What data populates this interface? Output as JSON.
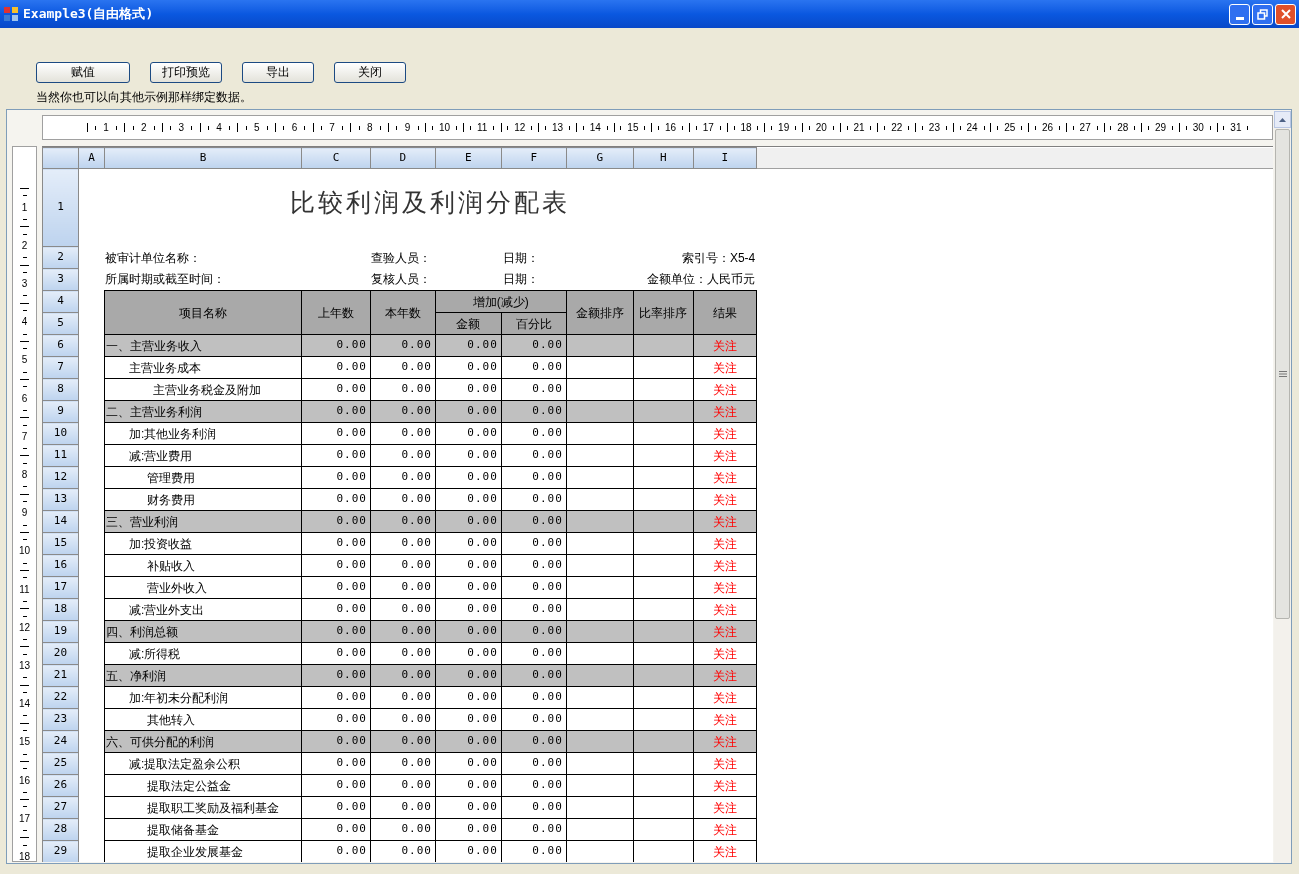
{
  "window": {
    "title": "Example3(自由格式)"
  },
  "buttons": [
    "赋值",
    "打印预览",
    "导出",
    "关闭"
  ],
  "note": "当然你也可以向其他示例那样绑定数据。",
  "ruler": {
    "marks": [
      "1",
      "2",
      "3",
      "4",
      "5",
      "6",
      "7",
      "8",
      "9",
      "10",
      "11",
      "12",
      "13",
      "14",
      "15",
      "16",
      "17",
      "18",
      "19",
      "20",
      "21",
      "22",
      "23",
      "24",
      "25",
      "26",
      "27",
      "28",
      "29",
      "30",
      "31"
    ]
  },
  "vertical_ruler": {
    "marks": [
      "1",
      "2",
      "3",
      "4",
      "5",
      "6",
      "7",
      "8",
      "9",
      "10",
      "11",
      "12",
      "13",
      "14",
      "15",
      "16",
      "17",
      "18"
    ]
  },
  "sheet": {
    "columns": [
      "A",
      "B",
      "C",
      "D",
      "E",
      "F",
      "G",
      "H",
      "I"
    ],
    "row_numbers": [
      "1",
      "2",
      "3",
      "4",
      "5",
      "6",
      "7",
      "8",
      "9",
      "10",
      "11",
      "12",
      "13",
      "14",
      "15",
      "16",
      "17",
      "18",
      "19",
      "20",
      "21",
      "22",
      "23",
      "24",
      "25",
      "26",
      "27",
      "28",
      "29"
    ],
    "title": "比较利润及利润分配表",
    "info_rows": [
      {
        "left": "被审计单位名称：",
        "reviewer": "查验人员：",
        "date": "日期：",
        "right": "索引号：X5-4"
      },
      {
        "left": "所属时期或截至时间：",
        "reviewer": "复核人员：",
        "date": "日期：",
        "right": "金额单位：人民币元"
      }
    ],
    "header": {
      "name": "项目名称",
      "prev": "上年数",
      "curr": "本年数",
      "change": "增加(减少)",
      "amount": "金额",
      "pct": "百分比",
      "amount_rank": "金额排序",
      "rate_rank": "比率排序",
      "result": "结果"
    },
    "rows": [
      {
        "name": "一、主营业务收入",
        "kind": "section",
        "prev": "0.00",
        "curr": "0.00",
        "amount": "0.00",
        "pct": "0.00",
        "result": "关注"
      },
      {
        "name": "主营业务成本",
        "kind": "item",
        "prev": "0.00",
        "curr": "0.00",
        "amount": "0.00",
        "pct": "0.00",
        "result": "关注"
      },
      {
        "name": "主营业务税金及附加",
        "kind": "deep",
        "prev": "0.00",
        "curr": "0.00",
        "amount": "0.00",
        "pct": "0.00",
        "result": "关注"
      },
      {
        "name": "二、主营业务利润",
        "kind": "section",
        "prev": "0.00",
        "curr": "0.00",
        "amount": "0.00",
        "pct": "0.00",
        "result": "关注"
      },
      {
        "name": "加:其他业务利润",
        "kind": "item",
        "prev": "0.00",
        "curr": "0.00",
        "amount": "0.00",
        "pct": "0.00",
        "result": "关注"
      },
      {
        "name": "减:营业费用",
        "kind": "item",
        "prev": "0.00",
        "curr": "0.00",
        "amount": "0.00",
        "pct": "0.00",
        "result": "关注"
      },
      {
        "name": "管理费用",
        "kind": "detail",
        "prev": "0.00",
        "curr": "0.00",
        "amount": "0.00",
        "pct": "0.00",
        "result": "关注"
      },
      {
        "name": "财务费用",
        "kind": "detail",
        "prev": "0.00",
        "curr": "0.00",
        "amount": "0.00",
        "pct": "0.00",
        "result": "关注"
      },
      {
        "name": "三、营业利润",
        "kind": "section",
        "prev": "0.00",
        "curr": "0.00",
        "amount": "0.00",
        "pct": "0.00",
        "result": "关注"
      },
      {
        "name": "加:投资收益",
        "kind": "item",
        "prev": "0.00",
        "curr": "0.00",
        "amount": "0.00",
        "pct": "0.00",
        "result": "关注"
      },
      {
        "name": "补贴收入",
        "kind": "detail",
        "prev": "0.00",
        "curr": "0.00",
        "amount": "0.00",
        "pct": "0.00",
        "result": "关注"
      },
      {
        "name": "营业外收入",
        "kind": "detail",
        "prev": "0.00",
        "curr": "0.00",
        "amount": "0.00",
        "pct": "0.00",
        "result": "关注"
      },
      {
        "name": "减:营业外支出",
        "kind": "item",
        "prev": "0.00",
        "curr": "0.00",
        "amount": "0.00",
        "pct": "0.00",
        "result": "关注"
      },
      {
        "name": "四、利润总额",
        "kind": "section",
        "prev": "0.00",
        "curr": "0.00",
        "amount": "0.00",
        "pct": "0.00",
        "result": "关注"
      },
      {
        "name": "减:所得税",
        "kind": "item",
        "prev": "0.00",
        "curr": "0.00",
        "amount": "0.00",
        "pct": "0.00",
        "result": "关注"
      },
      {
        "name": "五、净利润",
        "kind": "section",
        "prev": "0.00",
        "curr": "0.00",
        "amount": "0.00",
        "pct": "0.00",
        "result": "关注"
      },
      {
        "name": "加:年初未分配利润",
        "kind": "item",
        "prev": "0.00",
        "curr": "0.00",
        "amount": "0.00",
        "pct": "0.00",
        "result": "关注"
      },
      {
        "name": "其他转入",
        "kind": "detail",
        "prev": "0.00",
        "curr": "0.00",
        "amount": "0.00",
        "pct": "0.00",
        "result": "关注"
      },
      {
        "name": "六、可供分配的利润",
        "kind": "section",
        "prev": "0.00",
        "curr": "0.00",
        "amount": "0.00",
        "pct": "0.00",
        "result": "关注"
      },
      {
        "name": "减:提取法定盈余公积",
        "kind": "item",
        "prev": "0.00",
        "curr": "0.00",
        "amount": "0.00",
        "pct": "0.00",
        "result": "关注"
      },
      {
        "name": "提取法定公益金",
        "kind": "detail",
        "prev": "0.00",
        "curr": "0.00",
        "amount": "0.00",
        "pct": "0.00",
        "result": "关注"
      },
      {
        "name": "提取职工奖励及福利基金",
        "kind": "detail",
        "prev": "0.00",
        "curr": "0.00",
        "amount": "0.00",
        "pct": "0.00",
        "result": "关注"
      },
      {
        "name": "提取储备基金",
        "kind": "detail",
        "prev": "0.00",
        "curr": "0.00",
        "amount": "0.00",
        "pct": "0.00",
        "result": "关注"
      },
      {
        "name": "提取企业发展基金",
        "kind": "detail",
        "prev": "0.00",
        "curr": "0.00",
        "amount": "0.00",
        "pct": "0.00",
        "result": "关注"
      }
    ]
  }
}
